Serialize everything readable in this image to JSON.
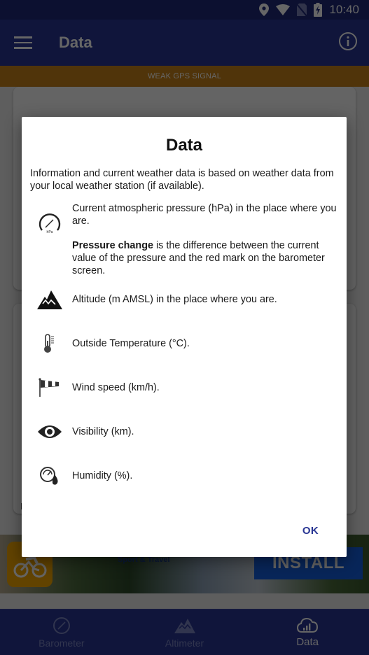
{
  "status_bar": {
    "time": "10:40",
    "icons": [
      "location-icon",
      "wifi-icon",
      "no-sim-icon",
      "battery-charging-icon"
    ]
  },
  "app_bar": {
    "menu_icon": "hamburger-menu-icon",
    "title": "Data",
    "info_icon": "info-icon"
  },
  "gps_banner": {
    "text": "WEAK GPS SIGNAL"
  },
  "background_partial_text": "L",
  "ad": {
    "tagline": "Sport & Travel",
    "install_label": "INSTALL",
    "app_icon": "cyclist-icon"
  },
  "bottom_nav": {
    "items": [
      {
        "label": "Barometer",
        "icon": "gauge-icon",
        "active": false
      },
      {
        "label": "Altimeter",
        "icon": "mountain-icon",
        "active": false
      },
      {
        "label": "Data",
        "icon": "cloud-chart-icon",
        "active": true
      }
    ]
  },
  "colors": {
    "primary": "#283593",
    "status_bar": "#1f2a78",
    "gps_warning": "#c8821a",
    "ok_button": "#283593",
    "ad_install": "#1560e0",
    "ad_app_icon": "#f6a800"
  },
  "dialog": {
    "title": "Data",
    "intro": "Information and current weather data is based on weather data from your local weather station (if available).",
    "items": [
      {
        "icon": "barometer-hpa-icon",
        "text": "Current atmospheric pressure (hPa) in the place where you are."
      },
      {
        "icon": "",
        "bold": "Pressure change",
        "text": " is the difference between the current value of the pressure and the red mark on the barometer screen."
      },
      {
        "icon": "mountain-icon",
        "text": "Altitude (m AMSL) in the place where you are."
      },
      {
        "icon": "thermometer-icon",
        "text": "Outside Temperature (°C)."
      },
      {
        "icon": "windsock-icon",
        "text": "Wind speed (km/h)."
      },
      {
        "icon": "eye-icon",
        "text": "Visibility (km)."
      },
      {
        "icon": "humidity-gauge-icon",
        "text": "Humidity (%)."
      }
    ],
    "ok_label": "OK"
  }
}
